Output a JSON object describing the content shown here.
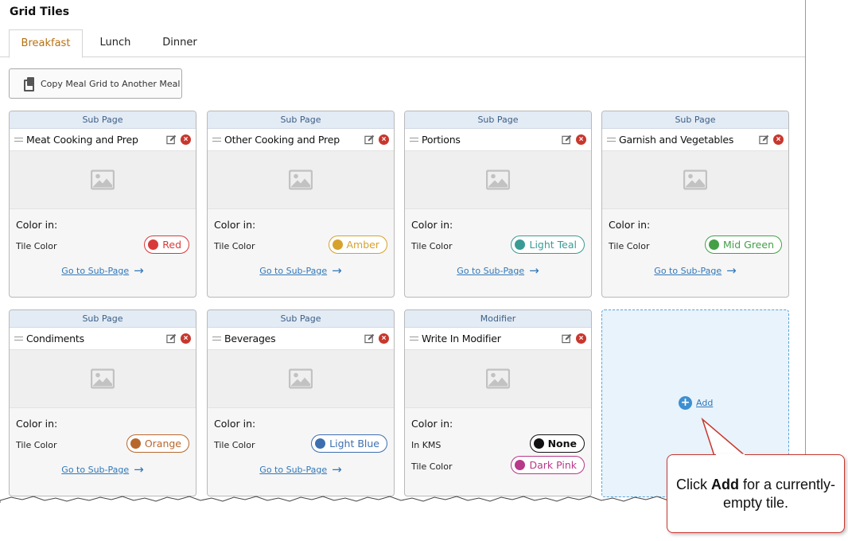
{
  "page": {
    "title": "Grid Tiles"
  },
  "tabs": [
    {
      "label": "Breakfast",
      "active": true
    },
    {
      "label": "Lunch",
      "active": false
    },
    {
      "label": "Dinner",
      "active": false
    }
  ],
  "toolbar": {
    "copy_label": "Copy Meal Grid to Another Meal"
  },
  "common": {
    "color_in": "Color in:",
    "tile_color": "Tile Color",
    "in_kms": "In KMS",
    "goto": "Go to Sub-Page",
    "add": "Add"
  },
  "tiles": [
    {
      "type": "Sub Page",
      "name": "Meat Cooking and Prep",
      "color_name": "Red",
      "color_hex": "#d83a3a",
      "goto": true
    },
    {
      "type": "Sub Page",
      "name": "Other Cooking and Prep",
      "color_name": "Amber",
      "color_hex": "#d6a22c",
      "goto": true
    },
    {
      "type": "Sub Page",
      "name": "Portions",
      "color_name": "Light Teal",
      "color_hex": "#3a9b95",
      "goto": true
    },
    {
      "type": "Sub Page",
      "name": "Garnish and Vegetables",
      "color_name": "Mid Green",
      "color_hex": "#43a047",
      "goto": true
    },
    {
      "type": "Sub Page",
      "name": "Condiments",
      "color_name": "Orange",
      "color_hex": "#b8672c",
      "goto": true
    },
    {
      "type": "Sub Page",
      "name": "Beverages",
      "color_name": "Light Blue",
      "color_hex": "#3d6fb0",
      "goto": true
    },
    {
      "type": "Modifier",
      "name": "Write In Modifier",
      "kms_name": "None",
      "kms_hex": "#111111",
      "color_name": "Dark Pink",
      "color_hex": "#b8388a",
      "goto": false
    }
  ],
  "callout": {
    "text_before": "Click ",
    "text_bold": "Add",
    "text_after": " for a currently-empty tile."
  },
  "colors": {
    "accent_tab": "#b87010",
    "link": "#3278b8",
    "callout_border": "#c8372d"
  }
}
